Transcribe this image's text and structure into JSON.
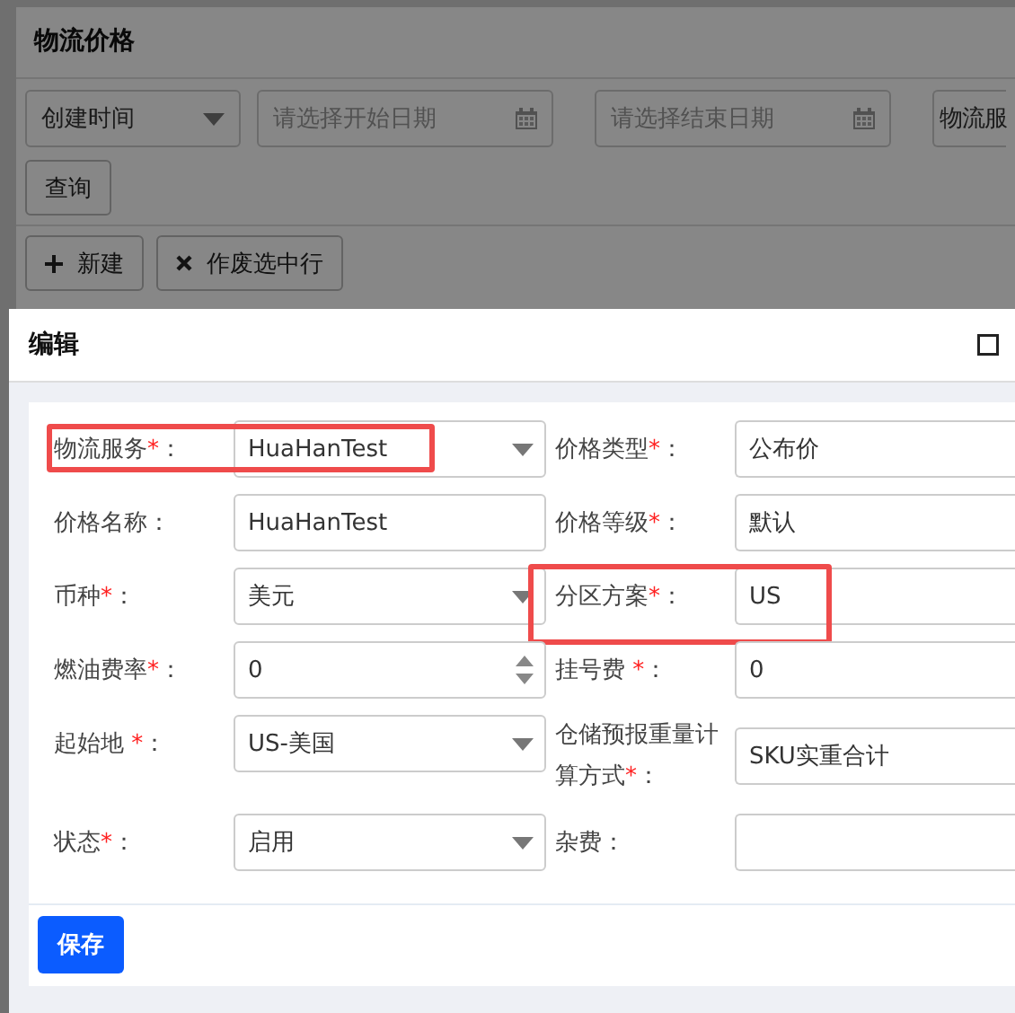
{
  "background": {
    "title": "物流价格",
    "filters": [
      {
        "kind": "select",
        "value": "创建时间"
      },
      {
        "kind": "date",
        "placeholder": "请选择开始日期"
      },
      {
        "kind": "date",
        "placeholder": "请选择结束日期"
      },
      {
        "kind": "text",
        "value": "物流服"
      }
    ],
    "search_button": "查询",
    "actions": [
      {
        "kind": "add",
        "label": "新建"
      },
      {
        "kind": "void",
        "label": "作废选中行"
      }
    ]
  },
  "dialog": {
    "title": "编辑",
    "fields": [
      {
        "label": "物流服务",
        "required_mark": "*",
        "suffix": "：",
        "kind": "select",
        "value": "HuaHanTest",
        "highlighted": true
      },
      {
        "label": "价格类型",
        "required_mark": "*",
        "suffix": "：",
        "kind": "text",
        "value": "公布价",
        "highlighted": false
      },
      {
        "label": "价格名称",
        "suffix": "：",
        "kind": "text",
        "value": "HuaHanTest",
        "highlighted": false
      },
      {
        "label": "价格等级",
        "required_mark": "*",
        "suffix": "：",
        "kind": "text",
        "value": "默认",
        "highlighted": false
      },
      {
        "label": "币种",
        "required_mark": "*",
        "suffix": "：",
        "kind": "select",
        "value": "美元",
        "highlighted": false
      },
      {
        "label": "分区方案",
        "required_mark": "*",
        "suffix": "：",
        "kind": "text",
        "value": "US",
        "highlighted": true
      },
      {
        "label": "燃油费率",
        "required_mark": "*",
        "suffix": "：",
        "kind": "number",
        "value": "0",
        "highlighted": false
      },
      {
        "label": "挂号费",
        "required_mark": " *",
        "suffix": "：",
        "kind": "text",
        "value": "0",
        "highlighted": false
      },
      {
        "label": "起始地",
        "required_mark": " *",
        "suffix": "：",
        "kind": "select",
        "value": "US-美国",
        "highlighted": false
      },
      {
        "label": "仓储预报重量计算方式",
        "required_mark": "*",
        "suffix": "：",
        "kind": "text",
        "value": "SKU实重合计",
        "highlighted": false
      },
      {
        "label": "状态",
        "required_mark": "*",
        "suffix": "：",
        "kind": "select",
        "value": "启用",
        "highlighted": false
      },
      {
        "label": "杂费",
        "suffix": "：",
        "kind": "text",
        "highlighted": false
      }
    ],
    "save_button": "保存"
  }
}
